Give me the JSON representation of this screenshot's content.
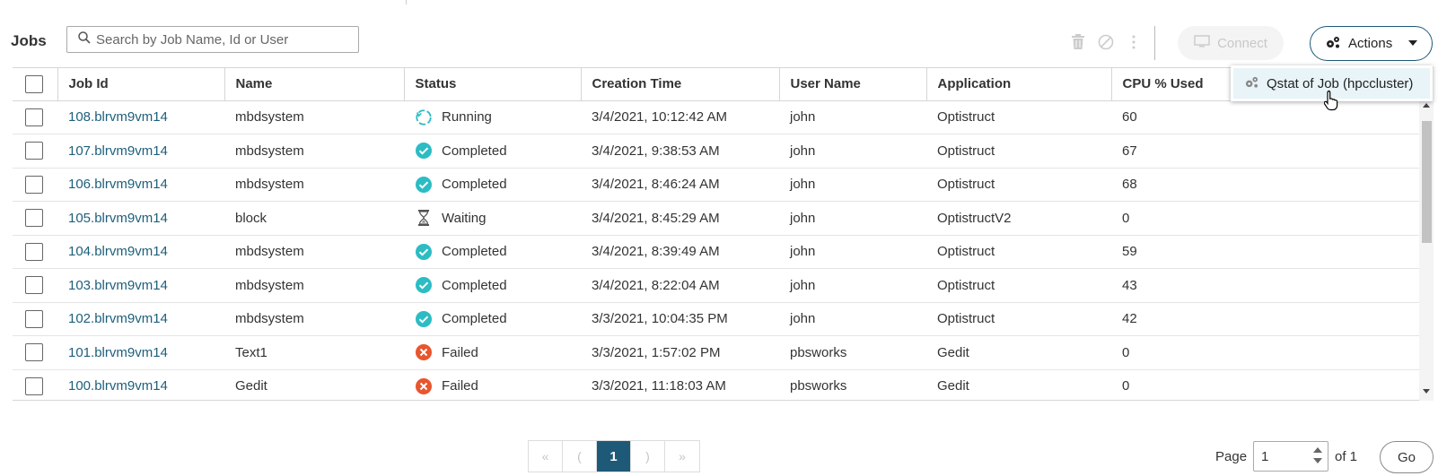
{
  "page_title": "Jobs",
  "search": {
    "placeholder": "Search by Job Name, Id or User",
    "value": ""
  },
  "toolbar": {
    "delete_icon": "trash-icon",
    "terminate_icon": "block-icon",
    "more_icon": "kebab-icon",
    "connect_label": "Connect",
    "actions_label": "Actions"
  },
  "actions_menu": {
    "items": [
      {
        "label": "Qstat of Job (hpccluster)",
        "icon": "gears-icon"
      }
    ]
  },
  "table": {
    "columns": [
      "Job Id",
      "Name",
      "Status",
      "Creation Time",
      "User Name",
      "Application",
      "CPU % Used"
    ],
    "rows": [
      {
        "job_id": "108.blrvm9vm14",
        "name": "mbdsystem",
        "status": "Running",
        "created": "3/4/2021, 10:12:42 AM",
        "user": "john",
        "app": "Optistruct",
        "cpu": "60"
      },
      {
        "job_id": "107.blrvm9vm14",
        "name": "mbdsystem",
        "status": "Completed",
        "created": "3/4/2021, 9:38:53 AM",
        "user": "john",
        "app": "Optistruct",
        "cpu": "67"
      },
      {
        "job_id": "106.blrvm9vm14",
        "name": "mbdsystem",
        "status": "Completed",
        "created": "3/4/2021, 8:46:24 AM",
        "user": "john",
        "app": "Optistruct",
        "cpu": "68"
      },
      {
        "job_id": "105.blrvm9vm14",
        "name": "block",
        "status": "Waiting",
        "created": "3/4/2021, 8:45:29 AM",
        "user": "john",
        "app": "OptistructV2",
        "cpu": "0"
      },
      {
        "job_id": "104.blrvm9vm14",
        "name": "mbdsystem",
        "status": "Completed",
        "created": "3/4/2021, 8:39:49 AM",
        "user": "john",
        "app": "Optistruct",
        "cpu": "59"
      },
      {
        "job_id": "103.blrvm9vm14",
        "name": "mbdsystem",
        "status": "Completed",
        "created": "3/4/2021, 8:22:04 AM",
        "user": "john",
        "app": "Optistruct",
        "cpu": "43"
      },
      {
        "job_id": "102.blrvm9vm14",
        "name": "mbdsystem",
        "status": "Completed",
        "created": "3/3/2021, 10:04:35 PM",
        "user": "john",
        "app": "Optistruct",
        "cpu": "42"
      },
      {
        "job_id": "101.blrvm9vm14",
        "name": "Text1",
        "status": "Failed",
        "created": "3/3/2021, 1:57:02 PM",
        "user": "pbsworks",
        "app": "Gedit",
        "cpu": "0"
      },
      {
        "job_id": "100.blrvm9vm14",
        "name": "Gedit",
        "status": "Failed",
        "created": "3/3/2021, 11:18:03 AM",
        "user": "pbsworks",
        "app": "Gedit",
        "cpu": "0"
      }
    ]
  },
  "status_colors": {
    "Completed": "#2bbcc4",
    "Failed": "#e8552e",
    "Running": "#2bbcc4",
    "Waiting": "#555555"
  },
  "pagination": {
    "first": "«",
    "prev": "(",
    "current": "1",
    "next": ")",
    "last": "»",
    "page_label": "Page",
    "page_value": "1",
    "of_label": "of 1",
    "go_label": "Go"
  }
}
